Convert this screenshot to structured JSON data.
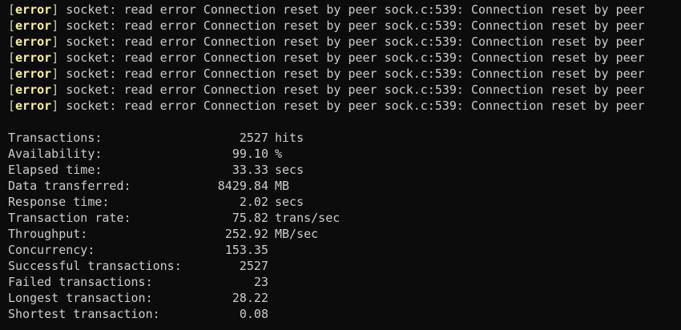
{
  "log": {
    "lines": [
      {
        "open": "[",
        "tag": "error",
        "close": "]",
        "message": " socket: read error Connection reset by peer sock.c:539: Connection reset by peer"
      },
      {
        "open": "[",
        "tag": "error",
        "close": "]",
        "message": " socket: read error Connection reset by peer sock.c:539: Connection reset by peer"
      },
      {
        "open": "[",
        "tag": "error",
        "close": "]",
        "message": " socket: read error Connection reset by peer sock.c:539: Connection reset by peer"
      },
      {
        "open": "[",
        "tag": "error",
        "close": "]",
        "message": " socket: read error Connection reset by peer sock.c:539: Connection reset by peer"
      },
      {
        "open": "[",
        "tag": "error",
        "close": "]",
        "message": " socket: read error Connection reset by peer sock.c:539: Connection reset by peer"
      },
      {
        "open": "[",
        "tag": "error",
        "close": "]",
        "message": " socket: read error Connection reset by peer sock.c:539: Connection reset by peer"
      },
      {
        "open": "[",
        "tag": "error",
        "close": "]",
        "message": " socket: read error Connection reset by peer sock.c:539: Connection reset by peer"
      }
    ]
  },
  "stats": {
    "rows": [
      {
        "label": "Transactions:",
        "value": "2527",
        "unit": "hits"
      },
      {
        "label": "Availability:",
        "value": "99.10",
        "unit": "%"
      },
      {
        "label": "Elapsed time:",
        "value": "33.33",
        "unit": "secs"
      },
      {
        "label": "Data transferred:",
        "value": "8429.84",
        "unit": "MB"
      },
      {
        "label": "Response time:",
        "value": "2.02",
        "unit": "secs"
      },
      {
        "label": "Transaction rate:",
        "value": "75.82",
        "unit": "trans/sec"
      },
      {
        "label": "Throughput:",
        "value": "252.92",
        "unit": "MB/sec"
      },
      {
        "label": "Concurrency:",
        "value": "153.35",
        "unit": ""
      },
      {
        "label": "Successful transactions:",
        "value": "2527",
        "unit": ""
      },
      {
        "label": "Failed transactions:",
        "value": "23",
        "unit": ""
      },
      {
        "label": "Longest transaction:",
        "value": "28.22",
        "unit": ""
      },
      {
        "label": "Shortest transaction:",
        "value": "0.08",
        "unit": ""
      }
    ]
  },
  "colors": {
    "background": "#0c0c0c",
    "text": "#cccccc",
    "error_tag": "#f9f1a5"
  }
}
